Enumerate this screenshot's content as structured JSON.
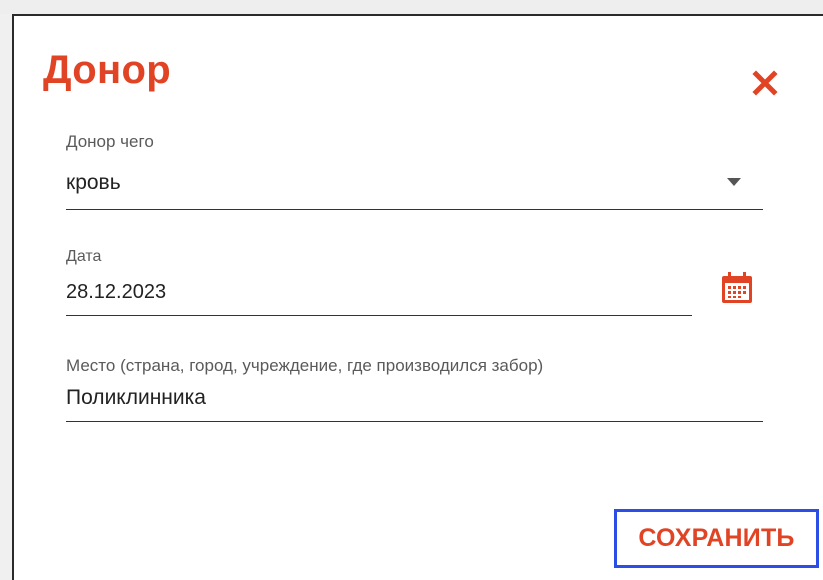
{
  "dialog": {
    "title": "Донор",
    "close_icon": "close-icon",
    "accent_color": "#e04425",
    "focus_color": "#2b4ee6"
  },
  "fields": {
    "donor_type": {
      "label": "Донор чего",
      "value": "кровь",
      "icon": "chevron-down-icon"
    },
    "date": {
      "label": "Дата",
      "value": "28.12.2023",
      "icon": "calendar-icon"
    },
    "place": {
      "label": "Место (страна, город, учреждение, где производился забор)",
      "value": "Поликлинника"
    }
  },
  "actions": {
    "save_label": "СОХРАНИТЬ"
  }
}
